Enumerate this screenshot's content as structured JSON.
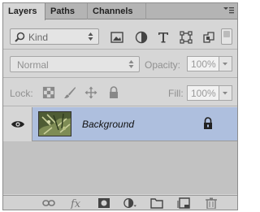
{
  "tabs": [
    {
      "label": "Layers",
      "active": true
    },
    {
      "label": "Paths",
      "active": false
    },
    {
      "label": "Channels",
      "active": false
    }
  ],
  "filter": {
    "kind_label": "Kind",
    "icons": [
      "pixel-filter-icon",
      "adjustment-filter-icon",
      "type-filter-icon",
      "shape-filter-icon",
      "smart-object-filter-icon"
    ]
  },
  "blend": {
    "mode": "Normal",
    "opacity_label": "Opacity:",
    "opacity_value": "100%"
  },
  "lock": {
    "label": "Lock:",
    "icons": [
      "lock-transparent-pixels-icon",
      "lock-image-pixels-icon",
      "lock-position-icon",
      "lock-all-icon"
    ],
    "fill_label": "Fill:",
    "fill_value": "100%"
  },
  "layers": [
    {
      "name": "Background",
      "visible": true,
      "locked": true,
      "selected": true
    }
  ],
  "bottom_icons": [
    "link-layers-icon",
    "fx-icon",
    "add-mask-icon",
    "new-adjustment-layer-icon",
    "new-group-icon",
    "new-layer-icon",
    "delete-layer-icon"
  ],
  "colors": {
    "selected_row": "#aebfde",
    "panel_bg": "#d6d6d6",
    "tab_bar": "#b4b4b4"
  }
}
